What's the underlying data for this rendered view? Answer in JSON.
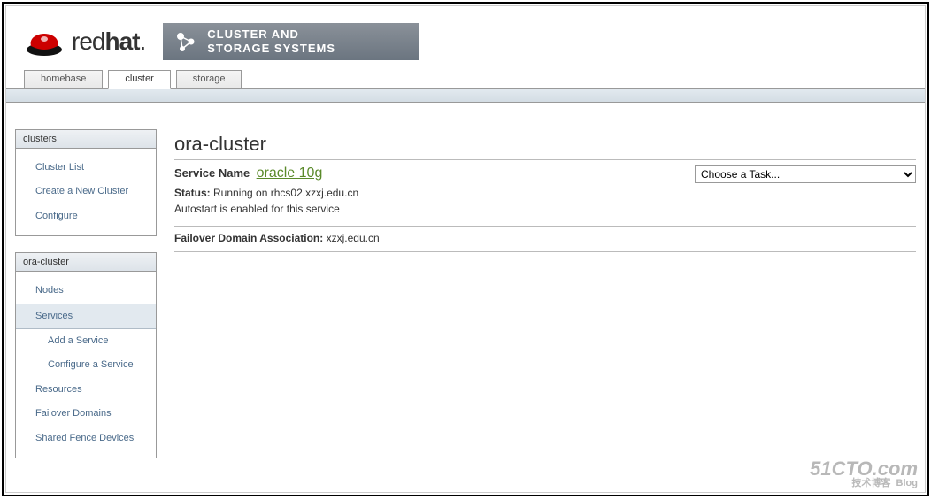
{
  "header": {
    "brand_part1": "red",
    "brand_part2": "hat",
    "product_line1": "CLUSTER AND",
    "product_line2": "STORAGE SYSTEMS"
  },
  "tabs": {
    "homebase": "homebase",
    "cluster": "cluster",
    "storage": "storage",
    "active": "cluster"
  },
  "sidebar": {
    "clusters": {
      "title": "clusters",
      "items": [
        {
          "label": "Cluster List"
        },
        {
          "label": "Create a New Cluster"
        },
        {
          "label": "Configure"
        }
      ]
    },
    "cluster": {
      "title": "ora-cluster",
      "items": [
        {
          "label": "Nodes"
        },
        {
          "label": "Services",
          "selected": true,
          "sub": [
            {
              "label": "Add a Service"
            },
            {
              "label": "Configure a Service"
            }
          ]
        },
        {
          "label": "Resources"
        },
        {
          "label": "Failover Domains"
        },
        {
          "label": "Shared Fence Devices"
        }
      ]
    }
  },
  "main": {
    "title": "ora-cluster",
    "service_name_label": "Service Name",
    "service_name_value": "oracle 10g",
    "status_label": "Status:",
    "status_value": "Running on rhcs02.xzxj.edu.cn",
    "autostart_text": "Autostart is enabled for this service",
    "failover_label": "Failover Domain Association:",
    "failover_value": "xzxj.edu.cn",
    "task_placeholder": "Choose a Task..."
  },
  "watermark": {
    "line1": "51CTO.com",
    "line2": "技术博客",
    "line3": "Blog"
  }
}
